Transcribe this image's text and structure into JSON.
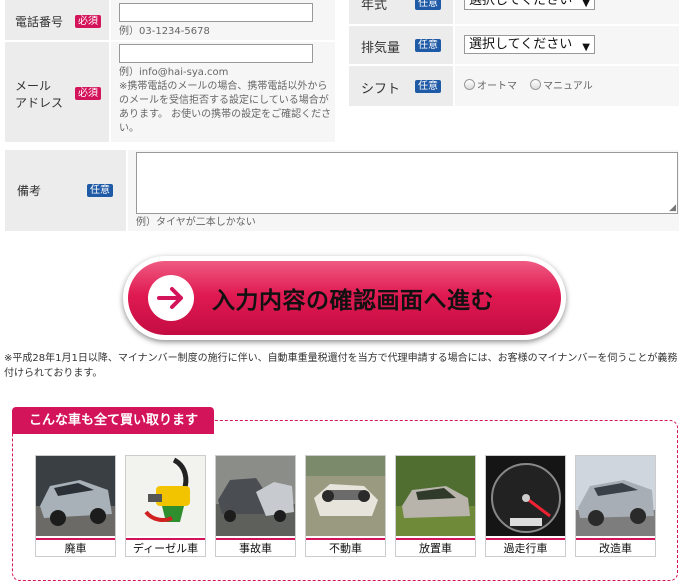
{
  "form": {
    "phone": {
      "label": "電話番号",
      "badge": "必須",
      "hint": "例）03-1234-5678"
    },
    "mail": {
      "label_line1": "メール",
      "label_line2": "アドレス",
      "badge": "必須",
      "hint": "例）info@hai-sya.com",
      "note_line1": "※携帯電話のメールの場合、携帯電話以外から",
      "note_line2": "のメールを受信拒否する設定にしている場合が",
      "note_line3": "あります。 お使いの携帯の設定をご確認くださ",
      "note_line4": "い。"
    },
    "year": {
      "label": "年式",
      "badge": "任意",
      "selected": "選択してください"
    },
    "displacement": {
      "label": "排気量",
      "badge": "任意",
      "selected": "選択してください"
    },
    "shift": {
      "label": "シフト",
      "badge": "任意",
      "option_auto": "オートマ",
      "option_manual": "マニュアル"
    },
    "remarks": {
      "label": "備考",
      "badge": "任意",
      "hint": "例）タイヤが二本しかない"
    }
  },
  "cta": {
    "label": "入力内容の確認画面へ進む"
  },
  "notice": {
    "line1": "※平成28年1月1日以降、マイナンバー制度の施行に伴い、自動車重量税還付を当方で代理申請する場合には、お客様のマイナンバーを伺うことが義務",
    "line2": "付けられております。"
  },
  "cars": {
    "title": "こんな車も全て買い取ります",
    "items": [
      {
        "label": "廃車"
      },
      {
        "label": "ディーゼル車"
      },
      {
        "label": "事故車"
      },
      {
        "label": "不動車"
      },
      {
        "label": "放置車"
      },
      {
        "label": "過走行車"
      },
      {
        "label": "改造車"
      }
    ]
  },
  "colors": {
    "required": "#d4145a",
    "optional": "#1f5aa6",
    "cta": "#e01a52"
  },
  "icons": {
    "cta": "arrow-right-circle-icon"
  }
}
